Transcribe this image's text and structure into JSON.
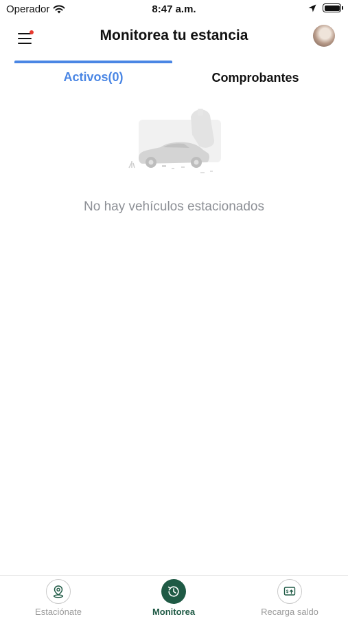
{
  "status_bar": {
    "carrier": "Operador",
    "time": "8:47 a.m."
  },
  "header": {
    "title": "Monitorea tu estancia"
  },
  "tabs": [
    {
      "label": "Activos(0)",
      "active": true
    },
    {
      "label": "Comprobantes",
      "active": false
    }
  ],
  "empty_state": {
    "message": "No hay vehículos estacionados"
  },
  "bottom_nav": {
    "items": [
      {
        "label": "Estaciónate",
        "icon": "location-pin-icon",
        "active": false
      },
      {
        "label": "Monitorea",
        "icon": "clock-history-icon",
        "active": true
      },
      {
        "label": "Recarga saldo",
        "icon": "recharge-icon",
        "active": false
      }
    ]
  },
  "colors": {
    "tab_active": "#4a86e4",
    "nav_active": "#1f5a45",
    "notification_dot": "#e8392e",
    "empty_text": "#8d9096"
  }
}
